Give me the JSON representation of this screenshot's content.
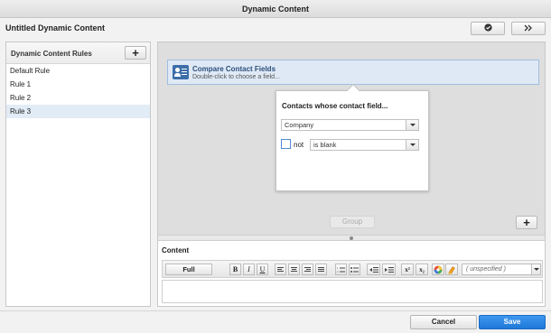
{
  "window": {
    "title": "Dynamic Content"
  },
  "header": {
    "title": "Untitled Dynamic Content",
    "check_icon": "check-icon",
    "expand_icon": "double-chevron-right-icon"
  },
  "sidebar": {
    "heading": "Dynamic Content Rules",
    "add_icon": "plus-icon",
    "items": [
      {
        "label": "Default Rule",
        "selected": false
      },
      {
        "label": "Rule 1",
        "selected": false
      },
      {
        "label": "Rule 2",
        "selected": false
      },
      {
        "label": "Rule 3",
        "selected": true
      }
    ]
  },
  "criteria": {
    "icon": "contact-card-icon",
    "title": "Compare Contact Fields",
    "subtitle": "Double-click to choose a field..."
  },
  "popup": {
    "title": "Contacts whose contact field...",
    "field_value": "Company",
    "not_label": "not",
    "not_checked": false,
    "operator_value": "is blank"
  },
  "canvas": {
    "group_label": "Group",
    "add_icon": "plus-icon"
  },
  "content": {
    "label": "Content",
    "toolbar": {
      "full_label": "Full",
      "bold": "B",
      "italic": "I",
      "underline": "U",
      "superscript": "x²",
      "subscript": "x₂",
      "style_value": "( unspecified )"
    }
  },
  "footer": {
    "cancel_label": "Cancel",
    "save_label": "Save"
  },
  "colors": {
    "primary": "#1e78d8",
    "selection": "#e2ecf7",
    "criteria_bg": "#dfe9f6"
  }
}
